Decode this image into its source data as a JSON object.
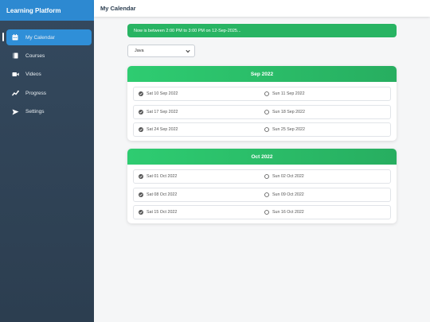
{
  "sidebar": {
    "title": "Learning Platform",
    "items": [
      {
        "label": "My Calendar",
        "icon": "calendar-icon",
        "active": true
      },
      {
        "label": "Courses",
        "icon": "book-icon",
        "active": false
      },
      {
        "label": "Videos",
        "icon": "video-icon",
        "active": false
      },
      {
        "label": "Progress",
        "icon": "chart-icon",
        "active": false
      },
      {
        "label": "Settings",
        "icon": "send-icon",
        "active": false
      }
    ]
  },
  "header": {
    "title": "My Calendar"
  },
  "banner": {
    "text": "Now is between 2:00 PM to 3:00 PM on 12-Sep-2025..."
  },
  "course_select": {
    "value": "Java"
  },
  "months": [
    {
      "title": "Sep 2022",
      "rows": [
        {
          "left": "Sat 10 Sep 2022",
          "left_checked": true,
          "right": "Sun 11 Sep 2022",
          "right_checked": false
        },
        {
          "left": "Sat 17 Sep 2022",
          "left_checked": true,
          "right": "Sun 18 Sep 2022",
          "right_checked": false
        },
        {
          "left": "Sat 24 Sep 2022",
          "left_checked": true,
          "right": "Sun 25 Sep 2022",
          "right_checked": false
        }
      ]
    },
    {
      "title": "Oct 2022",
      "rows": [
        {
          "left": "Sat 01 Oct 2022",
          "left_checked": true,
          "right": "Sun 02 Oct 2022",
          "right_checked": false
        },
        {
          "left": "Sat 08 Oct 2022",
          "left_checked": true,
          "right": "Sun 09 Oct 2022",
          "right_checked": false
        },
        {
          "left": "Sat 15 Oct 2022",
          "left_checked": true,
          "right": "Sun 16 Oct 2022",
          "right_checked": false
        }
      ]
    }
  ],
  "colors": {
    "sidebar_top": "#34495e",
    "sidebar_header": "#2d89d1",
    "active_item": "#2f8fd8",
    "green": "#28b463"
  }
}
